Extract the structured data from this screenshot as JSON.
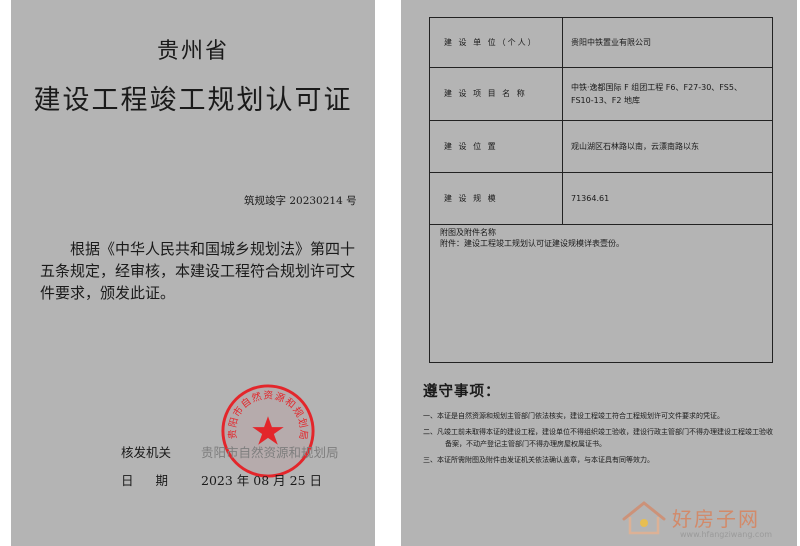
{
  "left_page": {
    "province": "贵州省",
    "title": "建设工程竣工规划认可证",
    "doc_number": "筑规竣字 20230214 号",
    "body": "根据《中华人民共和国城乡规划法》第四十五条规定，经审核，本建设工程符合规划许可文件要求，颁发此证。",
    "issuer_label": "核发机关",
    "issuer": "贵阳市自然资源和规划局",
    "date_label": "日 期",
    "date": "2023 年 08 月 25 日",
    "stamp_text": "贵阳市自然资源和规划局"
  },
  "right_page": {
    "table": [
      {
        "label": "建 设 单 位（个人）",
        "value": "贵阳中铁置业有限公司"
      },
      {
        "label": "建 设 项 目 名 称",
        "value_lines": [
          "中铁·逸都国际 F 组团工程 F6、F27-30、FS5、",
          "FS10-13、F2 地库"
        ]
      },
      {
        "label": "建 设 位 置",
        "value": "观山湖区石林路以南，云漂南路以东"
      },
      {
        "label": "建 设 规 模",
        "value": "71364.61"
      }
    ],
    "attachments_title": "附图及附件名称",
    "attachments": "附件：建设工程竣工规划认可证建设规模详表壹份。",
    "notice_title": "遵守事项：",
    "notices": [
      "一、本证是自然资源和规划主管部门依法核实，建设工程竣工符合工程规划许可文件要求的凭证。",
      "二、凡竣工前未取得本证的建设工程，建设单位不得组织竣工验收，建设行政主管部门不得办理建设工程竣工验收备案，不动产登记主管部门不得办理房屋权属证书。",
      "三、本证所需附图及附件由发证机关依法确认盖章，与本证具有同等效力。"
    ]
  },
  "watermark": {
    "name": "好房子网",
    "url": "www.hfangziwang.com"
  },
  "colors": {
    "paper": "#b4b4b4",
    "stamp_red": "#e3262b",
    "watermark_orange": "#d28a6a"
  }
}
